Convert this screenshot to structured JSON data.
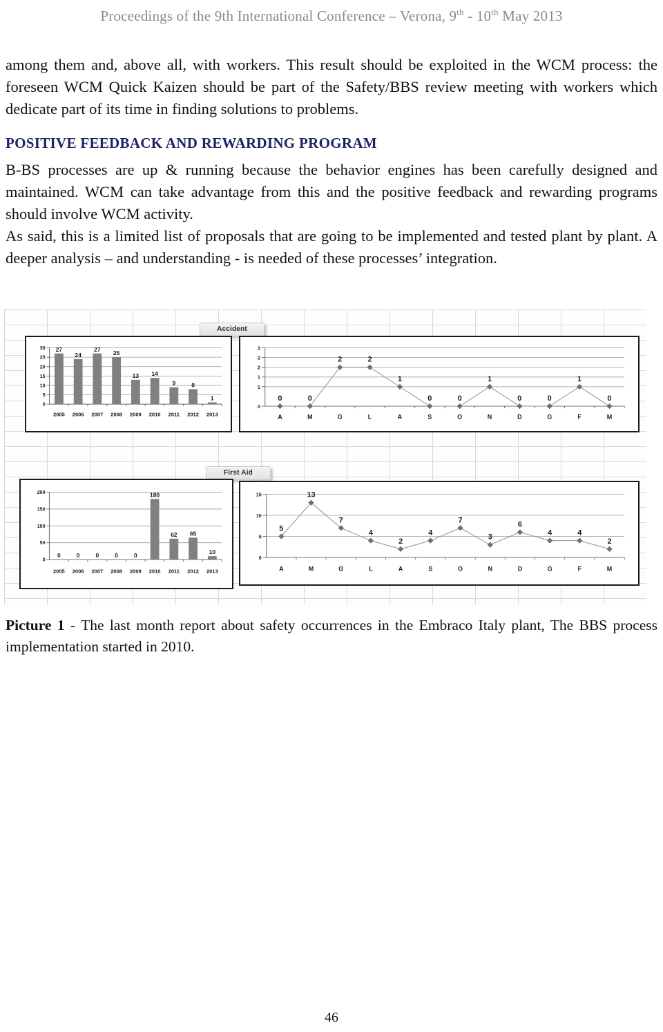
{
  "header": {
    "text_before": "Proceedings of the 9th International Conference – Verona, 9",
    "sup1": "th",
    "text_middle": " - 10",
    "sup2": "th",
    "text_after": " May 2013",
    "color": "#8a8a8a"
  },
  "body": {
    "paragraph_1": "among them and, above all, with workers. This result should be exploited in the WCM process: the foreseen WCM Quick Kaizen should be part of the Safety/BBS review meeting with workers which dedicate part of its time in finding solutions to problems.",
    "section_heading": "POSITIVE FEEDBACK AND REWARDING PROGRAM",
    "section_heading_color": "#1c2463",
    "paragraph_2": "B-BS processes are up & running because the behavior engines has been carefully designed and maintained. WCM can take advantage from this and the positive feedback and rewarding programs should involve WCM activity.",
    "paragraph_3": "As said, this is a limited list of proposals that are going to be implemented and tested plant by plant. A deeper analysis – and understanding - is needed of these processes’ integration."
  },
  "figure": {
    "tab_accident": "Accident",
    "tab_first_aid": "First Aid",
    "caption_label": "Picture 1",
    "caption_text": " - The last month report about safety occurrences in the Embraco Italy plant, The BBS process implementation started in 2010."
  },
  "page_number": "46",
  "chart_data": [
    {
      "type": "bar",
      "title": "Accident",
      "categories": [
        "2005",
        "2006",
        "2007",
        "2008",
        "2009",
        "2010",
        "2011",
        "2012",
        "2013"
      ],
      "values": [
        27,
        24,
        27,
        25,
        13,
        14,
        9,
        8,
        1
      ],
      "ytick_labels": [
        "30",
        "25",
        "20",
        "15",
        "10",
        "5",
        "0"
      ],
      "yticks": [
        30,
        25,
        20,
        15,
        10,
        5,
        0
      ],
      "ylim": [
        0,
        30
      ],
      "xlabel": "",
      "ylabel": "",
      "grid": true,
      "legend": "none",
      "bar_color": "#808080"
    },
    {
      "type": "line",
      "title": "Accident",
      "categories": [
        "A",
        "M",
        "G",
        "L",
        "A",
        "S",
        "O",
        "N",
        "D",
        "G",
        "F",
        "M"
      ],
      "values": [
        0,
        0,
        2,
        2,
        1,
        0,
        0,
        1,
        0,
        0,
        1,
        0
      ],
      "ytick_labels": [
        "3",
        "2",
        "2",
        "1",
        "1",
        "0"
      ],
      "yticks": [
        3,
        2.5,
        2,
        1.5,
        1,
        0
      ],
      "ylim": [
        0,
        3
      ],
      "xlabel": "",
      "ylabel": "",
      "grid": true,
      "legend": "none",
      "line_color": "#8e8e8e",
      "marker_color": "#6f6f6f"
    },
    {
      "type": "bar",
      "title": "First Aid",
      "categories": [
        "2005",
        "2006",
        "2007",
        "2008",
        "2009",
        "2010",
        "2011",
        "2012",
        "2013"
      ],
      "values": [
        0,
        0,
        0,
        0,
        0,
        180,
        62,
        65,
        10
      ],
      "ytick_labels": [
        "200",
        "150",
        "100",
        "50",
        "0"
      ],
      "yticks": [
        200,
        150,
        100,
        50,
        0
      ],
      "ylim": [
        0,
        200
      ],
      "xlabel": "",
      "ylabel": "",
      "grid": true,
      "legend": "none",
      "bar_color": "#808080"
    },
    {
      "type": "line",
      "title": "First Aid",
      "categories": [
        "A",
        "M",
        "G",
        "L",
        "A",
        "S",
        "O",
        "N",
        "D",
        "G",
        "F",
        "M"
      ],
      "values": [
        5,
        13,
        7,
        4,
        2,
        4,
        7,
        3,
        6,
        4,
        4,
        2
      ],
      "ytick_labels": [
        "15",
        "10",
        "5",
        "0"
      ],
      "yticks": [
        15,
        10,
        5,
        0
      ],
      "ylim": [
        0,
        15
      ],
      "xlabel": "",
      "ylabel": "",
      "grid": true,
      "legend": "none",
      "line_color": "#8e8e8e",
      "marker_color": "#6f6f6f"
    }
  ]
}
